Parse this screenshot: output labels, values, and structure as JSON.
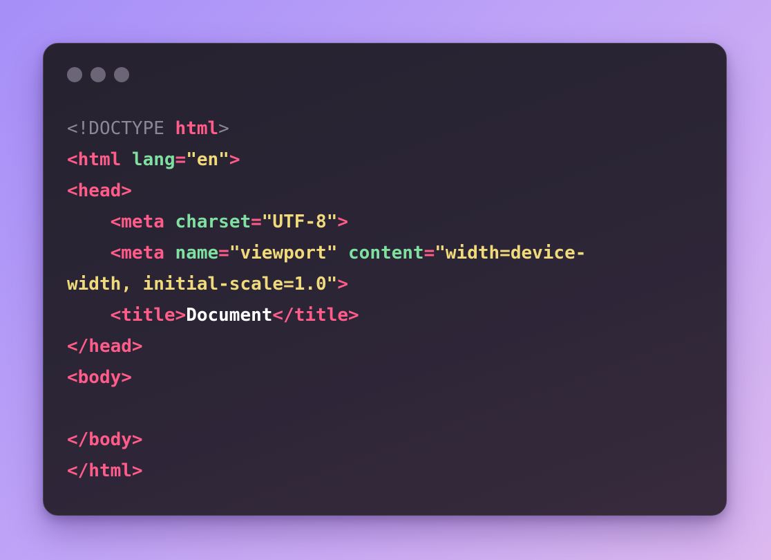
{
  "window": {
    "controls": [
      "window-dot",
      "window-dot",
      "window-dot"
    ]
  },
  "colors": {
    "doctype": "#8c8798",
    "tag": "#ff5c8a",
    "attribute": "#7fe0a0",
    "string": "#f1da7c",
    "text": "#ffffff"
  },
  "code": {
    "lines": [
      [
        {
          "t": "<!DOCTYPE ",
          "c": "gray"
        },
        {
          "t": "html",
          "c": "tag"
        },
        {
          "t": ">",
          "c": "gray"
        }
      ],
      [
        {
          "t": "<html ",
          "c": "tag"
        },
        {
          "t": "lang",
          "c": "attr"
        },
        {
          "t": "=",
          "c": "tag"
        },
        {
          "t": "\"en\"",
          "c": "str"
        },
        {
          "t": ">",
          "c": "tag"
        }
      ],
      [
        {
          "t": "<head>",
          "c": "tag"
        }
      ],
      [
        {
          "t": "    <meta ",
          "c": "tag"
        },
        {
          "t": "charset",
          "c": "attr"
        },
        {
          "t": "=",
          "c": "tag"
        },
        {
          "t": "\"UTF-8\"",
          "c": "str"
        },
        {
          "t": ">",
          "c": "tag"
        }
      ],
      [
        {
          "t": "    <meta ",
          "c": "tag"
        },
        {
          "t": "name",
          "c": "attr"
        },
        {
          "t": "=",
          "c": "tag"
        },
        {
          "t": "\"viewport\" ",
          "c": "str"
        },
        {
          "t": "content",
          "c": "attr"
        },
        {
          "t": "=",
          "c": "tag"
        },
        {
          "t": "\"width=device-",
          "c": "str"
        }
      ],
      [
        {
          "t": "width, initial-scale=1.0\"",
          "c": "str"
        },
        {
          "t": ">",
          "c": "tag"
        }
      ],
      [
        {
          "t": "    <title>",
          "c": "tag"
        },
        {
          "t": "Document",
          "c": "text"
        },
        {
          "t": "</title>",
          "c": "tag"
        }
      ],
      [
        {
          "t": "</head>",
          "c": "tag"
        }
      ],
      [
        {
          "t": "<body>",
          "c": "tag"
        }
      ],
      [],
      [
        {
          "t": "</body>",
          "c": "tag"
        }
      ],
      [
        {
          "t": "</html>",
          "c": "tag"
        }
      ]
    ]
  }
}
